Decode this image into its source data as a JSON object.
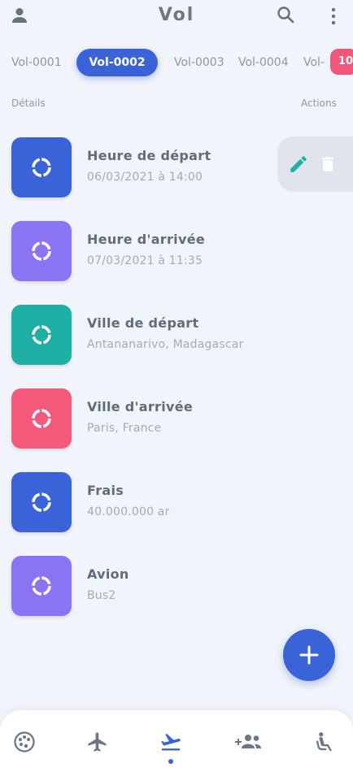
{
  "header": {
    "title": "Vol",
    "left_icon": "person-icon",
    "search_icon": "search-icon",
    "menu_icon": "more-vertical-icon"
  },
  "tabs": [
    {
      "label": "Vol-0001",
      "active": false
    },
    {
      "label": "Vol-0002",
      "active": true
    },
    {
      "label": "Vol-0003",
      "active": false
    },
    {
      "label": "Vol-0004",
      "active": false
    },
    {
      "label": "Vol-",
      "active": false
    }
  ],
  "tab_badge": "10",
  "sections": {
    "details_label": "Détails",
    "actions_label": "Actions"
  },
  "details": [
    {
      "label": "Heure de départ",
      "value": "06/03/2021 à 14:00",
      "color": "#3b63d8"
    },
    {
      "label": "Heure d'arrivée",
      "value": "07/03/2021 à 11:35",
      "color": "#8a74f4"
    },
    {
      "label": "Ville de départ",
      "value": "Antananarivo, Madagascar",
      "color": "#1fb0a5"
    },
    {
      "label": "Ville d'arrivée",
      "value": "Paris, France",
      "color": "#f45a7b"
    },
    {
      "label": "Frais",
      "value": "40.000.000 ar",
      "color": "#3b63d8"
    },
    {
      "label": "Avion",
      "value": "Bus2",
      "color": "#8a74f4"
    }
  ],
  "row_actions": {
    "edit_icon": "pencil-icon",
    "delete_icon": "trash-icon"
  },
  "fab": {
    "icon": "plus-icon"
  },
  "bottom_nav": [
    {
      "icon": "palette-icon",
      "active": false
    },
    {
      "icon": "airplane-icon",
      "active": false
    },
    {
      "icon": "airplane-departure-icon",
      "active": true
    },
    {
      "icon": "add-group-icon",
      "active": false
    },
    {
      "icon": "seat-recline-icon",
      "active": false
    }
  ],
  "colors": {
    "accent": "#3b63d8",
    "teal": "#1fb0a5",
    "purple": "#8a74f4",
    "pink": "#f45a7b",
    "background": "#f1f4fa"
  }
}
